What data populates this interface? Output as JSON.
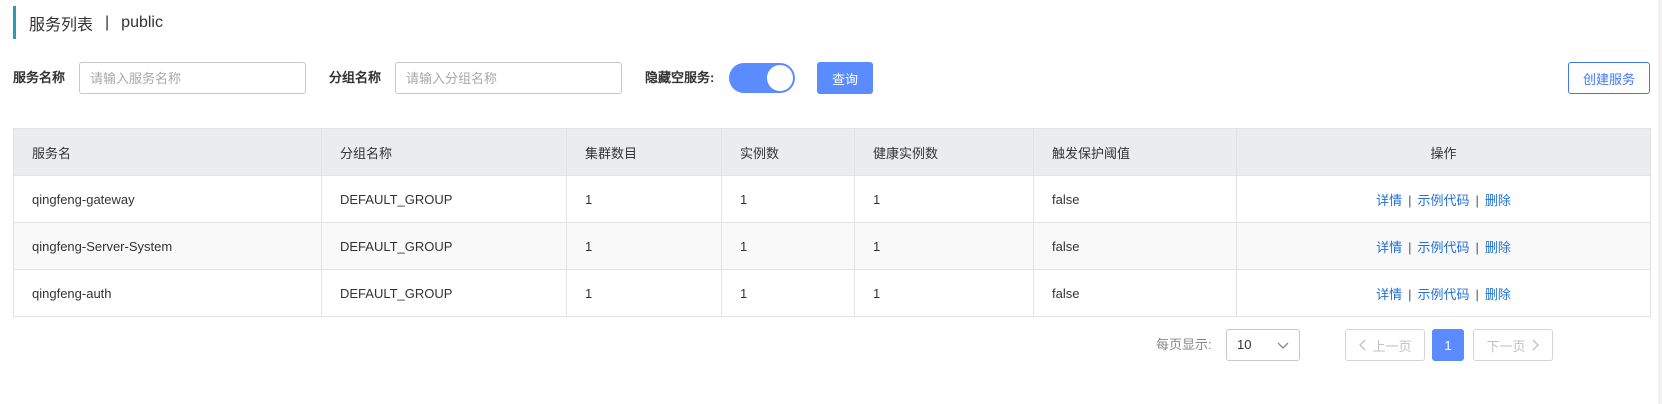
{
  "header": {
    "title": "服务列表",
    "separator": "|",
    "namespace": "public"
  },
  "filters": {
    "service_name_label": "服务名称",
    "service_name_placeholder": "请输入服务名称",
    "group_name_label": "分组名称",
    "group_name_placeholder": "请输入分组名称",
    "hide_empty_label": "隐藏空服务:",
    "hide_empty_on": true,
    "query_label": "查询",
    "create_label": "创建服务"
  },
  "table": {
    "columns": [
      "服务名",
      "分组名称",
      "集群数目",
      "实例数",
      "健康实例数",
      "触发保护阈值",
      "操作"
    ],
    "rows": [
      {
        "name": "qingfeng-gateway",
        "group": "DEFAULT_GROUP",
        "clusters": "1",
        "instances": "1",
        "healthy": "1",
        "protect": "false"
      },
      {
        "name": "qingfeng-Server-System",
        "group": "DEFAULT_GROUP",
        "clusters": "1",
        "instances": "1",
        "healthy": "1",
        "protect": "false"
      },
      {
        "name": "qingfeng-auth",
        "group": "DEFAULT_GROUP",
        "clusters": "1",
        "instances": "1",
        "healthy": "1",
        "protect": "false"
      }
    ],
    "actions": {
      "detail": "详情",
      "sample": "示例代码",
      "delete": "删除",
      "sep": "|"
    }
  },
  "pagination": {
    "per_page_label": "每页显示:",
    "per_page_value": "10",
    "prev_label": "上一页",
    "next_label": "下一页",
    "current_page": "1"
  },
  "colors": {
    "accent": "#5b8cff",
    "title_bar": "#2b9ab8",
    "link": "#1f6fd6",
    "header_bg": "#ebecee"
  }
}
